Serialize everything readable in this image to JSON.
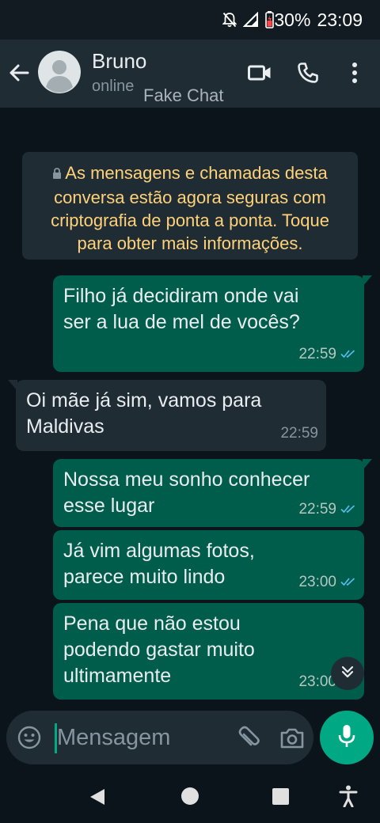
{
  "status_bar": {
    "battery": "30%",
    "time": "23:09",
    "icons": [
      "mute-icon",
      "signal-icon",
      "battery-icon"
    ]
  },
  "header": {
    "contact_name": "Bruno",
    "contact_status": "online",
    "watermark": "Fake Chat",
    "icons": [
      "back-icon",
      "avatar",
      "video-call-icon",
      "phone-icon",
      "more-vert-icon"
    ]
  },
  "chat": {
    "encryption_notice": "As mensagens e chamadas desta conversa estão agora seguras com criptografia de ponta a ponta. Toque para obter mais informações.",
    "messages": [
      {
        "direction": "out",
        "lines": [
          "Filho já decidiram onde vai",
          "ser a lua de mel de vocês?"
        ],
        "time": "22:59",
        "status": "read"
      },
      {
        "direction": "in",
        "lines": [
          "Oi mãe já sim, vamos para",
          "Maldivas"
        ],
        "time": "22:59"
      },
      {
        "direction": "out",
        "lines": [
          "Nossa meu sonho conhecer",
          "esse lugar"
        ],
        "time": "22:59",
        "status": "read"
      },
      {
        "direction": "out",
        "lines": [
          "Já vim algumas fotos,",
          "parece muito lindo"
        ],
        "time": "23:00",
        "status": "read"
      },
      {
        "direction": "out",
        "lines": [
          "Pena que não estou",
          "podendo gastar muito",
          "ultimamente"
        ],
        "time": "23:00",
        "status": "read"
      }
    ]
  },
  "composer": {
    "placeholder": "Mensagem",
    "icons": [
      "emoji-icon",
      "attach-icon",
      "camera-icon",
      "mic-icon"
    ]
  },
  "colors": {
    "background": "#0b141a",
    "header": "#1f2c34",
    "outgoing_bubble": "#005c4b",
    "incoming_bubble": "#1f2c34",
    "accent": "#00a884",
    "notice_text": "#ffd279",
    "read_ticks": "#53bdeb"
  }
}
